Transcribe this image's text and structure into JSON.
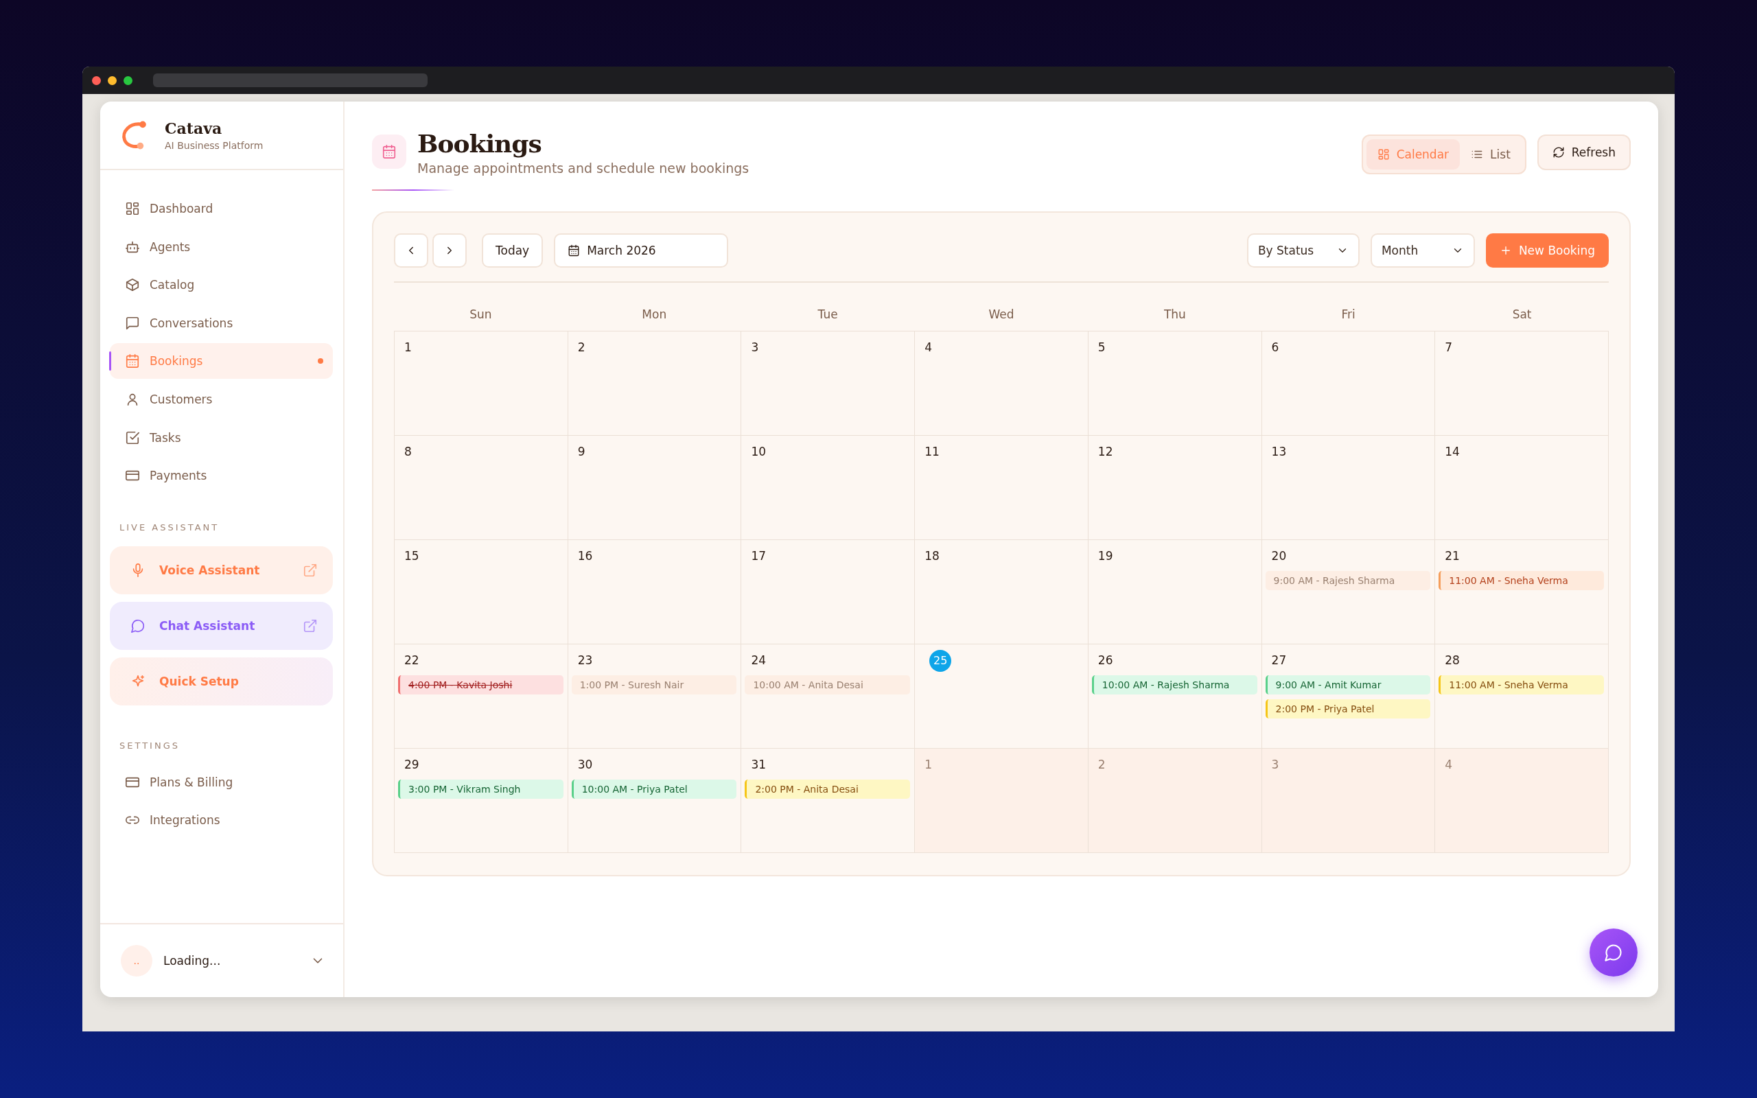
{
  "brand": {
    "name": "Catava",
    "tagline": "AI Business Platform"
  },
  "nav": [
    {
      "label": "Dashboard",
      "selected": false,
      "dot": false
    },
    {
      "label": "Agents",
      "selected": false,
      "dot": false
    },
    {
      "label": "Catalog",
      "selected": false,
      "dot": false
    },
    {
      "label": "Conversations",
      "selected": false,
      "dot": false
    },
    {
      "label": "Bookings",
      "selected": true,
      "dot": true
    },
    {
      "label": "Customers",
      "selected": false,
      "dot": false
    },
    {
      "label": "Tasks",
      "selected": false,
      "dot": false
    },
    {
      "label": "Payments",
      "selected": false,
      "dot": false
    }
  ],
  "live_assistant": {
    "heading": "LIVE ASSISTANT",
    "items": [
      {
        "kind": "voice",
        "label": "Voice Assistant",
        "external": true
      },
      {
        "kind": "chat",
        "label": "Chat Assistant",
        "external": true
      },
      {
        "kind": "setup",
        "label": "Quick Setup",
        "external": false
      }
    ]
  },
  "settings": {
    "heading": "SETTINGS",
    "items": [
      {
        "label": "Plans & Billing"
      },
      {
        "label": "Integrations"
      }
    ]
  },
  "user": {
    "name": "Loading...",
    "avatar": ".."
  },
  "page": {
    "title": "Bookings",
    "subtitle": "Manage appointments and schedule new bookings"
  },
  "views": [
    {
      "label": "Calendar",
      "selected": true
    },
    {
      "label": "List",
      "selected": false
    }
  ],
  "refresh": "Refresh",
  "toolbar": {
    "today": "Today",
    "month": "March 2026",
    "filter": "By Status",
    "range": "Month",
    "new_booking": "New Booking"
  },
  "weekdays": [
    "Sun",
    "Mon",
    "Tue",
    "Wed",
    "Thu",
    "Fri",
    "Sat"
  ],
  "weeks": [
    [
      {
        "day": "1",
        "outside": false,
        "today": false
      },
      {
        "day": "2",
        "outside": false,
        "today": false
      },
      {
        "day": "3",
        "outside": false,
        "today": false
      },
      {
        "day": "4",
        "outside": false,
        "today": false
      },
      {
        "day": "5",
        "outside": false,
        "today": false
      },
      {
        "day": "6",
        "outside": false,
        "today": false
      },
      {
        "day": "7",
        "outside": false,
        "today": false
      }
    ],
    [
      {
        "day": "8",
        "outside": false,
        "today": false
      },
      {
        "day": "9",
        "outside": false,
        "today": false
      },
      {
        "day": "10",
        "outside": false,
        "today": false
      },
      {
        "day": "11",
        "outside": false,
        "today": false
      },
      {
        "day": "12",
        "outside": false,
        "today": false
      },
      {
        "day": "13",
        "outside": false,
        "today": false
      },
      {
        "day": "14",
        "outside": false,
        "today": false
      }
    ],
    [
      {
        "day": "15",
        "outside": false,
        "today": false
      },
      {
        "day": "16",
        "outside": false,
        "today": false
      },
      {
        "day": "17",
        "outside": false,
        "today": false
      },
      {
        "day": "18",
        "outside": false,
        "today": false
      },
      {
        "day": "19",
        "outside": false,
        "today": false
      },
      {
        "day": "20",
        "outside": false,
        "today": false,
        "events": [
          {
            "text": "9:00 AM - Rajesh Sharma",
            "kind": "past"
          }
        ]
      },
      {
        "day": "21",
        "outside": false,
        "today": false,
        "events": [
          {
            "text": "11:00 AM - Sneha Verma",
            "kind": "completed"
          }
        ]
      }
    ],
    [
      {
        "day": "22",
        "outside": false,
        "today": false,
        "events": [
          {
            "text": "4:00 PM - Kavita Joshi",
            "kind": "cancelled"
          }
        ]
      },
      {
        "day": "23",
        "outside": false,
        "today": false,
        "events": [
          {
            "text": "1:00 PM - Suresh Nair",
            "kind": "past"
          }
        ]
      },
      {
        "day": "24",
        "outside": false,
        "today": false,
        "events": [
          {
            "text": "10:00 AM - Anita Desai",
            "kind": "past"
          }
        ]
      },
      {
        "day": "25",
        "outside": false,
        "today": true
      },
      {
        "day": "26",
        "outside": false,
        "today": false,
        "events": [
          {
            "text": "10:00 AM - Rajesh Sharma",
            "kind": "confirmed"
          }
        ]
      },
      {
        "day": "27",
        "outside": false,
        "today": false,
        "events": [
          {
            "text": "9:00 AM - Amit Kumar",
            "kind": "confirmed"
          },
          {
            "text": "2:00 PM - Priya Patel",
            "kind": "pending"
          }
        ]
      },
      {
        "day": "28",
        "outside": false,
        "today": false,
        "events": [
          {
            "text": "11:00 AM - Sneha Verma",
            "kind": "pending"
          }
        ]
      }
    ],
    [
      {
        "day": "29",
        "outside": false,
        "today": false,
        "events": [
          {
            "text": "3:00 PM - Vikram Singh",
            "kind": "confirmed"
          }
        ]
      },
      {
        "day": "30",
        "outside": false,
        "today": false,
        "events": [
          {
            "text": "10:00 AM - Priya Patel",
            "kind": "confirmed"
          }
        ]
      },
      {
        "day": "31",
        "outside": false,
        "today": false,
        "events": [
          {
            "text": "2:00 PM - Anita Desai",
            "kind": "pending"
          }
        ]
      },
      {
        "day": "1",
        "outside": true,
        "today": false
      },
      {
        "day": "2",
        "outside": true,
        "today": false
      },
      {
        "day": "3",
        "outside": true,
        "today": false
      },
      {
        "day": "4",
        "outside": true,
        "today": false
      }
    ]
  ]
}
